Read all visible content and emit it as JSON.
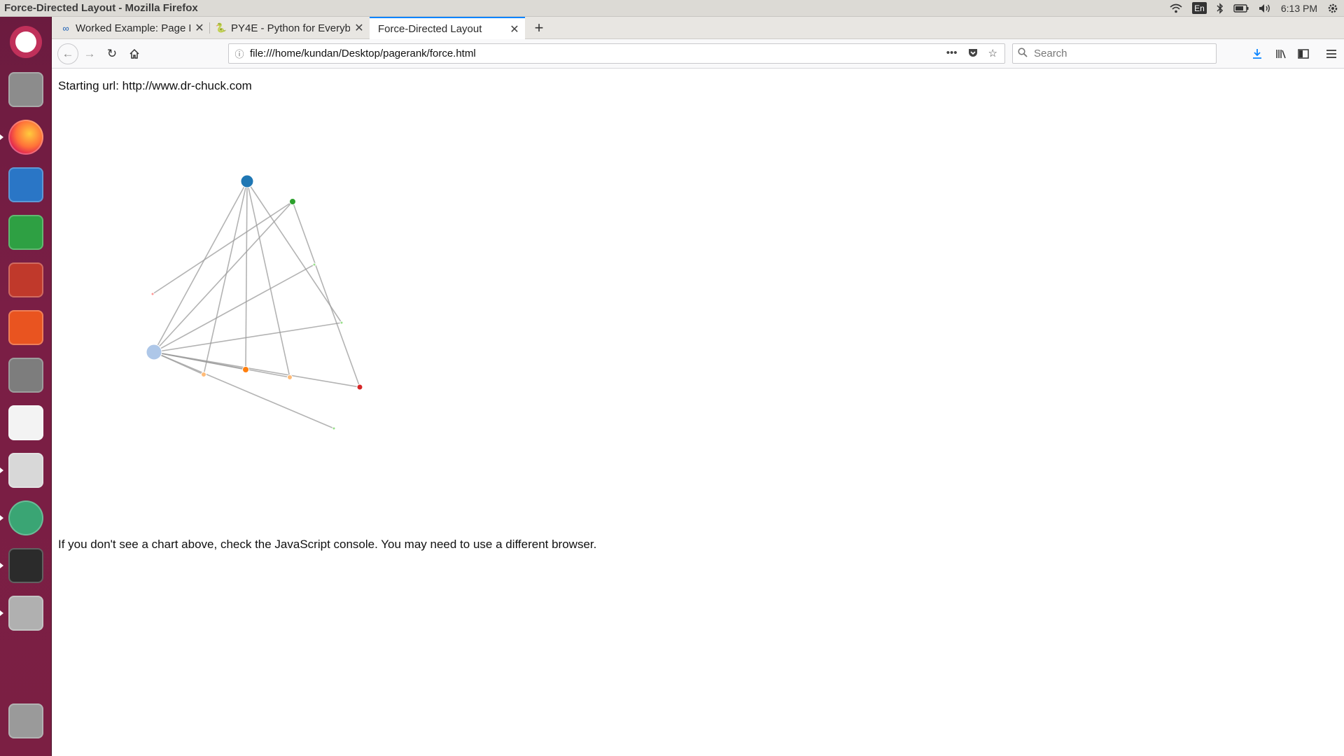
{
  "window": {
    "title": "Force-Directed Layout - Mozilla Firefox"
  },
  "panel": {
    "language": "En",
    "clock": "6:13 PM"
  },
  "launcher": {
    "items": [
      {
        "name": "ubuntu-dash-icon",
        "color": "#c0305a"
      },
      {
        "name": "files-icon",
        "color": "#8c8c8c"
      },
      {
        "name": "firefox-icon",
        "color": "#e66000"
      },
      {
        "name": "libreoffice-writer-icon",
        "color": "#2a76c6"
      },
      {
        "name": "libreoffice-calc-icon",
        "color": "#2ea043"
      },
      {
        "name": "libreoffice-impress-icon",
        "color": "#c0392b"
      },
      {
        "name": "software-center-icon",
        "color": "#e95420"
      },
      {
        "name": "system-settings-icon",
        "color": "#7d7d7d"
      },
      {
        "name": "amazon-icon",
        "color": "#f3f3f3"
      },
      {
        "name": "text-editor-icon",
        "color": "#d8d8d8"
      },
      {
        "name": "atom-icon",
        "color": "#3aa574"
      },
      {
        "name": "terminal-icon",
        "color": "#2b2b2b"
      },
      {
        "name": "database-icon",
        "color": "#b0b0b0"
      },
      {
        "name": "trash-icon",
        "color": "#9a9a9a"
      }
    ]
  },
  "tabs": [
    {
      "label": "Worked Example: Page R",
      "favicon": "∞",
      "active": false
    },
    {
      "label": "PY4E - Python for Everyb",
      "favicon": "🐍",
      "active": false
    },
    {
      "label": "Force-Directed Layout",
      "favicon": "",
      "active": true
    }
  ],
  "nav": {
    "url": "file:///home/kundan/Desktop/pagerank/force.html",
    "search_placeholder": "Search"
  },
  "page": {
    "starting_url": "Starting url: http://www.dr-chuck.com",
    "note": "If you don't see a chart above, check the JavaScript console. You may need to use a different browser."
  },
  "graph": {
    "nodes": [
      {
        "id": "n0",
        "color": "#1f77b4",
        "size": 9
      },
      {
        "id": "n1",
        "color": "#2ca02c",
        "size": 4.5
      },
      {
        "id": "n2",
        "color": "#98df8a",
        "size": 2
      },
      {
        "id": "n3",
        "color": "#98df8a",
        "size": 2
      },
      {
        "id": "n4",
        "color": "#ff9896",
        "size": 2
      },
      {
        "id": "n5",
        "color": "#aec7e8",
        "size": 11
      },
      {
        "id": "n6",
        "color": "#ffbb78",
        "size": 3.5
      },
      {
        "id": "n7",
        "color": "#ff7f0e",
        "size": 4.5
      },
      {
        "id": "n8",
        "color": "#ffbb78",
        "size": 3.5
      },
      {
        "id": "n9",
        "color": "#d62728",
        "size": 4
      },
      {
        "id": "n10",
        "color": "#98df8a",
        "size": 2
      }
    ],
    "links": [
      [
        "n0",
        "n5"
      ],
      [
        "n0",
        "n6"
      ],
      [
        "n0",
        "n7"
      ],
      [
        "n0",
        "n8"
      ],
      [
        "n0",
        "n3"
      ],
      [
        "n1",
        "n5"
      ],
      [
        "n1",
        "n4"
      ],
      [
        "n1",
        "n9"
      ],
      [
        "n2",
        "n5"
      ],
      [
        "n3",
        "n5"
      ],
      [
        "n5",
        "n6"
      ],
      [
        "n5",
        "n7"
      ],
      [
        "n5",
        "n8"
      ],
      [
        "n5",
        "n9"
      ],
      [
        "n5",
        "n10"
      ]
    ]
  }
}
